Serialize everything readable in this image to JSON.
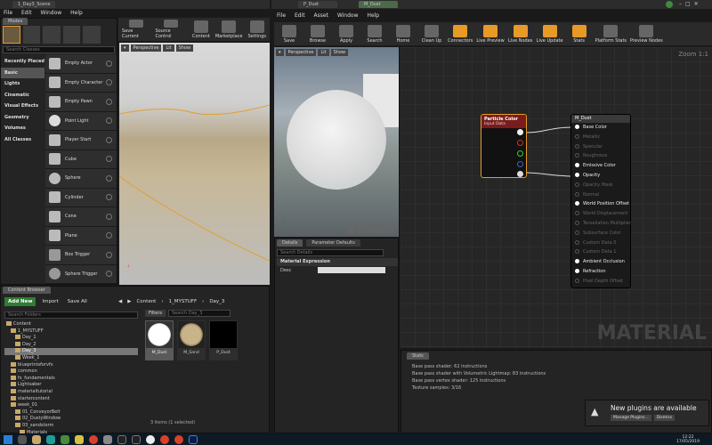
{
  "left_window": {
    "title": "1_Day3_Scene",
    "tab": "Modes",
    "menu": [
      "File",
      "Edit",
      "Window",
      "Help"
    ],
    "search_placeholder": "Search Classes",
    "categories": [
      "Recently Placed",
      "Basic",
      "Lights",
      "Cinematic",
      "Visual Effects",
      "Geometry",
      "Volumes",
      "All Classes"
    ],
    "selected_category": "Basic",
    "place_items": [
      "Empty Actor",
      "Empty Character",
      "Empty Pawn",
      "Point Light",
      "Player Start",
      "Cube",
      "Sphere",
      "Cylinder",
      "Cone",
      "Plane",
      "Box Trigger",
      "Sphere Trigger"
    ],
    "toolbar": [
      "Save Current",
      "Source Control",
      "Content",
      "Marketplace",
      "Settings"
    ],
    "viewport": {
      "perspective": "Perspective",
      "lit": "Lit",
      "show": "Show"
    }
  },
  "content_browser": {
    "tab": "Content Browser",
    "add_new": "Add New",
    "import": "Import",
    "save_all": "Save All",
    "path": [
      "Content",
      "1_MYSTUFF",
      "Day_3"
    ],
    "search_folders": "Search Folders",
    "filters": "Filters",
    "search_assets": "Search Day_3",
    "folders": [
      {
        "name": "Content",
        "indent": 0
      },
      {
        "name": "1_MYSTUFF",
        "indent": 1
      },
      {
        "name": "Day_1",
        "indent": 2
      },
      {
        "name": "Day_2",
        "indent": 2
      },
      {
        "name": "Day_3",
        "indent": 2,
        "selected": true
      },
      {
        "name": "Week_1",
        "indent": 2
      },
      {
        "name": "blueprintsforvfx",
        "indent": 1
      },
      {
        "name": "common",
        "indent": 1
      },
      {
        "name": "fx_fundamentals",
        "indent": 1
      },
      {
        "name": "Lightsaber",
        "indent": 1
      },
      {
        "name": "materialtutorial",
        "indent": 1
      },
      {
        "name": "startercontent",
        "indent": 1
      },
      {
        "name": "week_01",
        "indent": 1
      },
      {
        "name": "01_ConveyorBelt",
        "indent": 2
      },
      {
        "name": "02_DustyWindow",
        "indent": 2
      },
      {
        "name": "03_sandstorm",
        "indent": 2
      },
      {
        "name": "Materials",
        "indent": 3
      },
      {
        "name": "Particles",
        "indent": 3
      }
    ],
    "assets": [
      "M_Dust",
      "M_Sand",
      "P_Dust"
    ],
    "status": "3 items (1 selected)"
  },
  "right_window": {
    "tabs": [
      "P_Dust",
      "M_Dust"
    ],
    "menu": [
      "File",
      "Edit",
      "Asset",
      "Window",
      "Help"
    ],
    "toolbar": [
      {
        "label": "Save",
        "orange": false
      },
      {
        "label": "Browse",
        "orange": false
      },
      {
        "label": "Apply",
        "orange": false
      },
      {
        "label": "Search",
        "orange": false
      },
      {
        "label": "Home",
        "orange": false
      },
      {
        "label": "Clean Up",
        "orange": false
      },
      {
        "label": "Connectors",
        "orange": true
      },
      {
        "label": "Live Preview",
        "orange": true
      },
      {
        "label": "Live Nodes",
        "orange": true
      },
      {
        "label": "Live Update",
        "orange": true
      },
      {
        "label": "Stats",
        "orange": true
      },
      {
        "label": "Platform Stats",
        "orange": false
      },
      {
        "label": "Preview Nodes",
        "orange": false
      }
    ],
    "viewport": {
      "perspective": "Perspective",
      "lit": "Lit",
      "show": "Show"
    },
    "details_tabs": [
      "Details",
      "Parameter Defaults"
    ],
    "search_details": "Search Details",
    "section": "Material Expression",
    "desc_label": "Desc",
    "zoom": "Zoom 1:1",
    "watermark": "MATERIAL",
    "particle_node": {
      "title": "Particle Color",
      "subtitle": "Input Data"
    },
    "material_node": {
      "title": "M_Dust",
      "pins": [
        {
          "name": "Base Color",
          "on": true
        },
        {
          "name": "Metallic",
          "on": false
        },
        {
          "name": "Specular",
          "on": false
        },
        {
          "name": "Roughness",
          "on": false
        },
        {
          "name": "Emissive Color",
          "on": true
        },
        {
          "name": "Opacity",
          "on": true
        },
        {
          "name": "Opacity Mask",
          "on": false
        },
        {
          "name": "Normal",
          "on": false
        },
        {
          "name": "World Position Offset",
          "on": true
        },
        {
          "name": "World Displacement",
          "on": false
        },
        {
          "name": "Tessellation Multiplier",
          "on": false
        },
        {
          "name": "Subsurface Color",
          "on": false
        },
        {
          "name": "Custom Data 0",
          "on": false
        },
        {
          "name": "Custom Data 1",
          "on": false
        },
        {
          "name": "Ambient Occlusion",
          "on": true
        },
        {
          "name": "Refraction",
          "on": true
        },
        {
          "name": "Pixel Depth Offset",
          "on": false
        }
      ]
    },
    "stats_tab": "Stats",
    "stats": [
      "Base pass shader: 62 instructions",
      "Base pass shader with Volumetric Lightmap: 83 instructions",
      "Base pass vertex shader: 125 instructions",
      "Texture samples: 3/16"
    ],
    "notification": {
      "title": "New plugins are available",
      "manage": "Manage Plugins...",
      "dismiss": "Dismiss"
    }
  },
  "taskbar": {
    "time": "12:22",
    "date": "17/05/2019"
  }
}
